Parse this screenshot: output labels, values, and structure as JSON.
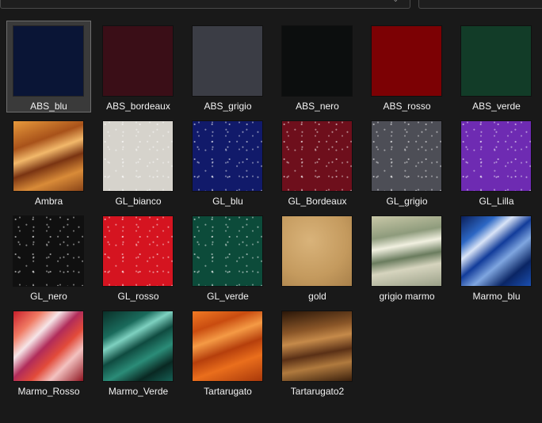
{
  "items": [
    {
      "label": "ABS_blu",
      "color": "#0a1536",
      "texture": "flat",
      "selected": true
    },
    {
      "label": "ABS_bordeaux",
      "color": "#3a0e17",
      "texture": "flat"
    },
    {
      "label": "ABS_grigio",
      "color": "#3b3d45",
      "texture": "flat"
    },
    {
      "label": "ABS_nero",
      "color": "#0c0e0e",
      "texture": "flat"
    },
    {
      "label": "ABS_rosso",
      "color": "#7c0104",
      "texture": "flat"
    },
    {
      "label": "ABS_verde",
      "color": "#123c28",
      "texture": "flat"
    },
    {
      "label": "Ambra",
      "color": "#c26a1c",
      "texture": "amber"
    },
    {
      "label": "GL_bianco",
      "color": "#d6d3cc",
      "texture": "glitter"
    },
    {
      "label": "GL_blu",
      "color": "#111a6a",
      "texture": "glitter"
    },
    {
      "label": "GL_Bordeaux",
      "color": "#6e0f1c",
      "texture": "glitter"
    },
    {
      "label": "GL_grigio",
      "color": "#4d4e56",
      "texture": "glitter"
    },
    {
      "label": "GL_Lilla",
      "color": "#6e2bb2",
      "texture": "glitter"
    },
    {
      "label": "GL_nero",
      "color": "#101010",
      "texture": "glitter"
    },
    {
      "label": "GL_rosso",
      "color": "#d51420",
      "texture": "glitter"
    },
    {
      "label": "GL_verde",
      "color": "#0c4b3a",
      "texture": "glitter"
    },
    {
      "label": "gold",
      "color": "#cda46a",
      "texture": "gold"
    },
    {
      "label": "grigio marmo",
      "color": "#8b9a7d",
      "texture": "grigio-marmo"
    },
    {
      "label": "Marmo_blu",
      "color": "#12368a",
      "texture": "marmo-blu"
    },
    {
      "label": "Marmo_Rosso",
      "color": "#b0202a",
      "texture": "marmo-rosso"
    },
    {
      "label": "Marmo_Verde",
      "color": "#0f4a40",
      "texture": "marmo-verde"
    },
    {
      "label": "Tartarugato",
      "color": "#e1621a",
      "texture": "tartarugato"
    },
    {
      "label": "Tartarugato2",
      "color": "#6e3a1a",
      "texture": "tartarugato2"
    }
  ]
}
